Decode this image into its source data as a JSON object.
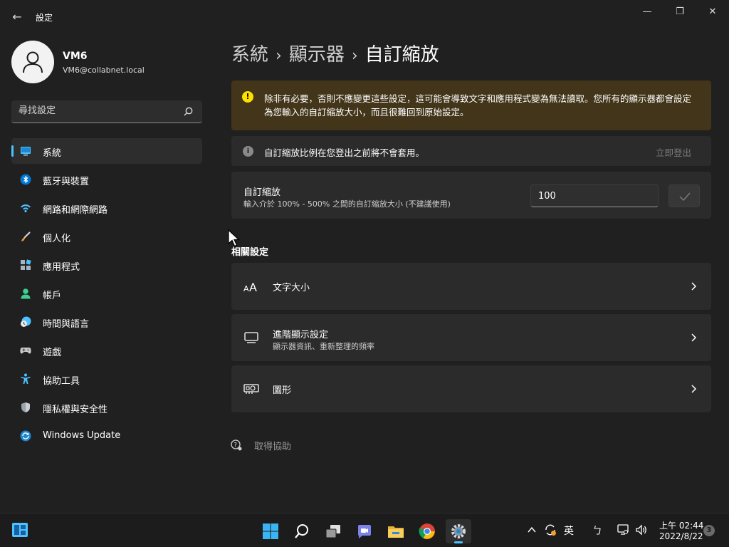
{
  "window": {
    "app_title": "設定",
    "back_glyph": "←",
    "minimize_glyph": "—",
    "maximize_glyph": "❐",
    "close_glyph": "✕"
  },
  "profile": {
    "name": "VM6",
    "email": "VM6@collabnet.local"
  },
  "search": {
    "placeholder": "尋找設定"
  },
  "sidebar": {
    "items": [
      {
        "label": "系統",
        "icon": "monitor-icon",
        "active": true
      },
      {
        "label": "藍牙與裝置",
        "icon": "bluetooth-icon"
      },
      {
        "label": "網路和網際網路",
        "icon": "wifi-icon"
      },
      {
        "label": "個人化",
        "icon": "brush-icon"
      },
      {
        "label": "應用程式",
        "icon": "apps-icon"
      },
      {
        "label": "帳戶",
        "icon": "person-icon"
      },
      {
        "label": "時間與語言",
        "icon": "globe-clock-icon"
      },
      {
        "label": "遊戲",
        "icon": "gamepad-icon"
      },
      {
        "label": "協助工具",
        "icon": "accessibility-icon"
      },
      {
        "label": "隱私權與安全性",
        "icon": "shield-icon"
      },
      {
        "label": "Windows Update",
        "icon": "update-icon"
      }
    ]
  },
  "breadcrumb": {
    "level1": "系統",
    "level2": "顯示器",
    "current": "自訂縮放",
    "separator": "›"
  },
  "warning": {
    "icon_glyph": "!",
    "text": "除非有必要，否則不應變更這些設定，這可能會導致文字和應用程式變為無法讀取。您所有的顯示器都會設定為您輸入的自訂縮放大小，而且很難回到原始設定。"
  },
  "info": {
    "icon_glyph": "i",
    "text": "自訂縮放比例在您登出之前將不會套用。",
    "signout_label": "立即登出"
  },
  "custom_scaling": {
    "title": "自訂縮放",
    "description": "輸入介於 100% - 500% 之間的自訂縮放大小 (不建議使用)",
    "value": "100"
  },
  "related": {
    "section_title": "相關設定",
    "items": [
      {
        "title": "文字大小",
        "description": "",
        "icon": "text-size-icon"
      },
      {
        "title": "進階顯示設定",
        "description": "顯示器資訊、重新整理的頻率",
        "icon": "display-icon"
      },
      {
        "title": "圖形",
        "description": "",
        "icon": "graphics-card-icon"
      }
    ]
  },
  "help": {
    "label": "取得協助"
  },
  "taskbar": {
    "ime_primary": "英",
    "ime_secondary": "ㄅ",
    "clock_time": "上午 02:44",
    "clock_date": "2022/8/22",
    "notification_count": "3"
  },
  "colors": {
    "accent": "#4cc2ff",
    "warning_bg": "#433519",
    "warning_icon": "#fce100",
    "card_bg": "#2b2b2b",
    "window_bg": "#202020"
  }
}
